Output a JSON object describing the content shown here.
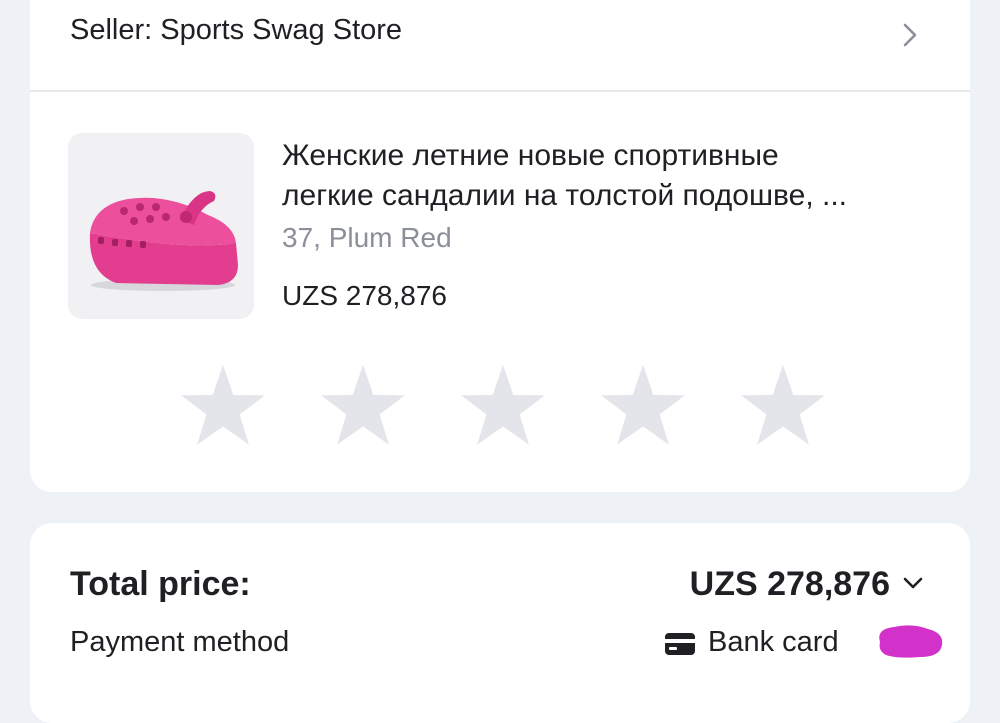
{
  "seller": {
    "label": "Seller: Sports Swag Store",
    "chevron_icon": "chevron-right-icon"
  },
  "product": {
    "title_line1": "Женские летние новые спортивные",
    "title_line2": "легкие сандалии на толстой подошве, ...",
    "variant": "37, Plum Red",
    "price": "UZS 278,876",
    "image_icon": "pink-platform-clog-image",
    "color": "#e23d8f"
  },
  "rating": {
    "stars": [
      "star-1",
      "star-2",
      "star-3",
      "star-4",
      "star-5"
    ],
    "selected": 0,
    "empty_color": "#e3e5ea"
  },
  "summary": {
    "total_label": "Total price:",
    "total_value": "UZS 278,876",
    "payment_label": "Payment method",
    "payment_value": "Bank card",
    "payment_icon": "bank-card-icon",
    "redaction_color": "#d232c9"
  }
}
